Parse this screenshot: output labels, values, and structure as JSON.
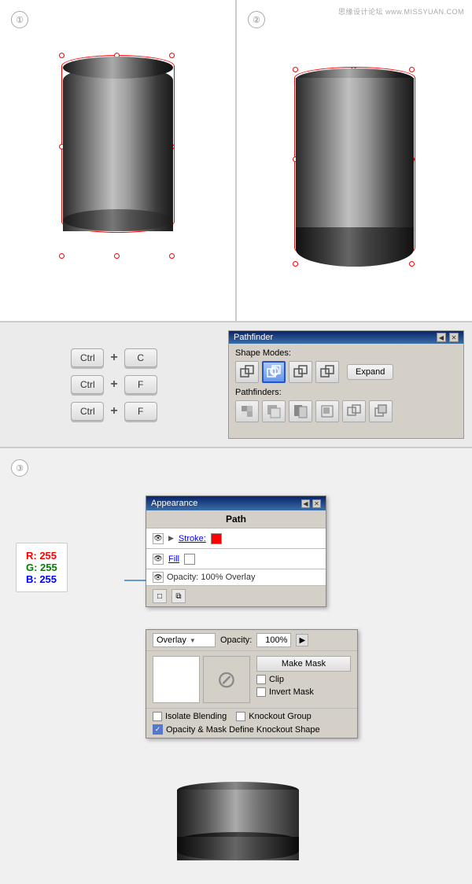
{
  "watermark": {
    "text": "思缘设计论坛 www.MISSYUAN.COM"
  },
  "steps": {
    "step1": "①",
    "step2": "②",
    "step3": "③"
  },
  "keyboard_shortcuts": [
    {
      "key1": "Ctrl",
      "key2": "C"
    },
    {
      "key1": "Ctrl",
      "key2": "F"
    },
    {
      "key1": "Ctrl",
      "key2": "F"
    }
  ],
  "pathfinder": {
    "title": "Pathfinder",
    "shape_modes_label": "Shape Modes:",
    "pathfinders_label": "Pathfinders:",
    "expand_btn": "Expand"
  },
  "appearance": {
    "title": "Appearance",
    "path_label": "Path",
    "stroke_label": "Stroke:",
    "fill_label": "Fill",
    "opacity_label": "Opacity: 100% Overlay"
  },
  "transparency": {
    "blend_mode": "Overlay",
    "opacity_label": "Opacity:",
    "opacity_value": "100%",
    "make_mask_btn": "Make Mask",
    "clip_label": "Clip",
    "invert_mask_label": "Invert Mask",
    "isolate_blending_label": "Isolate Blending",
    "knockout_group_label": "Knockout Group",
    "opacity_mask_label": "Opacity & Mask Define Knockout Shape"
  },
  "rgb": {
    "r_label": "R: 255",
    "g_label": "G: 255",
    "b_label": "B: 255"
  }
}
